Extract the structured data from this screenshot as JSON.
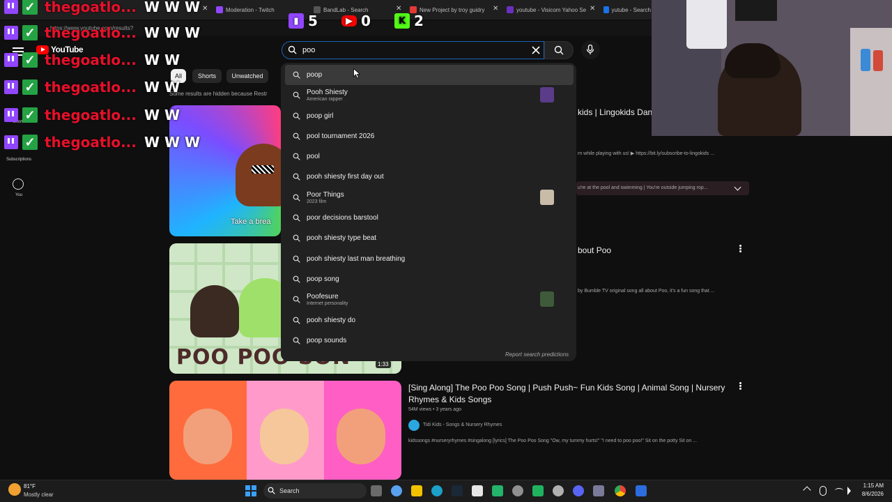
{
  "browser": {
    "tabs": [
      {
        "label": "Moderation - Twitch",
        "color": "#9146ff"
      },
      {
        "label": "BandLab - Search",
        "color": "#555555"
      },
      {
        "label": "New Project by troy guidry",
        "color": "#e53935"
      },
      {
        "label": "youtube - Visicom Yahoo Se",
        "color": "#6b2fbf"
      },
      {
        "label": "yutube - Search",
        "color": "#1a73e8"
      }
    ],
    "close_glyph": "✕",
    "url": "https://www.youtube.com/results?"
  },
  "overlay": {
    "stats": [
      {
        "platform": "twitch",
        "count": "5",
        "color": "#9146ff"
      },
      {
        "platform": "youtube",
        "count": "0",
        "color": "#ff0000"
      },
      {
        "platform": "kick",
        "count": "2",
        "color": "#53fc18"
      }
    ],
    "chat": [
      {
        "name": "thegoatlo...",
        "message": "W W W"
      },
      {
        "name": "thegoatlo...",
        "message": "W W W"
      },
      {
        "name": "thegoatlo...",
        "message": "W W"
      },
      {
        "name": "thegoatlo...",
        "message": "W W"
      },
      {
        "name": "thegoatlo...",
        "message": "W W"
      },
      {
        "name": "thegoatlo...",
        "message": "W W W"
      }
    ]
  },
  "youtube": {
    "logo": "YouTube",
    "sidebar": {
      "shorts": "Shorts",
      "subscriptions": "Subscriptions",
      "you": "You"
    },
    "chips": [
      "All",
      "Shorts",
      "Unwatched"
    ],
    "hidden_note": "Some results are hidden because Restr",
    "search": {
      "query": "poo"
    },
    "suggestions": [
      {
        "text": "poop"
      },
      {
        "text": "Pooh Shiesty",
        "sub": "American rapper",
        "thumb": true
      },
      {
        "text": "poop girl"
      },
      {
        "text": "pool tournament 2026"
      },
      {
        "text": "pool"
      },
      {
        "text": "pooh shiesty first day out"
      },
      {
        "text": "Poor Things",
        "sub": "2023 film",
        "thumb": true
      },
      {
        "text": "poor decisions barstool"
      },
      {
        "text": "pooh shiesty type beat"
      },
      {
        "text": "pooh shiesty last man breathing"
      },
      {
        "text": "poop song"
      },
      {
        "text": "Poofesure",
        "sub": "Internet personality",
        "thumb": true
      },
      {
        "text": "pooh shiesty do"
      },
      {
        "text": "poop sounds"
      }
    ],
    "report": "Report search predictions",
    "results": {
      "r1_title": "kids | Lingokids Dan",
      "r1_desc": "rn while playing with us! ▶ https://bit.ly/subscribe-to-lingokids ...",
      "r1_chapter": "u're at the pool and swimming | You're outside jumping rop...",
      "r1_overlay": "Take a brea",
      "r2_title": "bout Poo",
      "r2_desc": "by Bumble TV original song all about Poo, it's a fun song that ...",
      "r2_overlay": "POO POO SON",
      "r2_duration": "1:33",
      "r3_title": "[Sing Along] The Poo Poo Song | Push Push~ Fun Kids Song | Animal Song | Nursery Rhymes & Kids Songs",
      "r3_meta": "54M views • 3 years ago",
      "r3_channel": "Tidi Kids - Songs & Nursery Rhymes",
      "r3_desc": "kidssongs #nurseryrhymes #singalong [lyrics] The Poo Poo Song \"Ow, my tummy hurts!\" \"I need to poo poo!\" Sit on the potty Sit on ..."
    }
  },
  "taskbar": {
    "weather_temp": "81°F",
    "weather_desc": "Mostly clear",
    "search_label": "Search",
    "time": "1:15 AM",
    "date": "8/6/2026"
  }
}
